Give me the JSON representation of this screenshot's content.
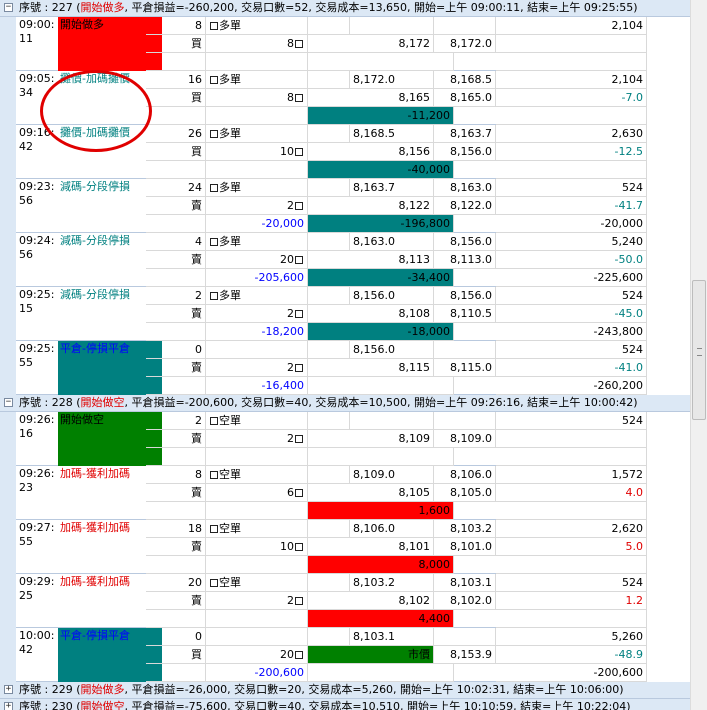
{
  "groups": [
    {
      "expander": "−",
      "prefix": "序號 : 227 (",
      "kind": "開始做多",
      "summary": ", 平倉損益=-260,200, 交易口數=52, 交易成本=13,650, 開始=上午 09:00:11, 結束=上午 09:25:55)",
      "blocks": [
        {
          "time1": "09:00:",
          "time2": "11",
          "action": "開始做多",
          "action_style": "bg-red",
          "r1": {
            "qty": "8",
            "side": "多單",
            "entry": "",
            "price": "",
            "right": "2,104"
          },
          "r2": {
            "dir": "買",
            "lots": "8",
            "num": "8,172",
            "price": "8,172.0",
            "right": ""
          },
          "r3": {
            "pnl": "",
            "bar": "",
            "right": "",
            "bar_style": ""
          }
        },
        {
          "time1": "09:05:",
          "time2": "34",
          "action": "攤價-加碼攤價",
          "action_style": "c-teal",
          "r1": {
            "qty": "16",
            "side": "多單",
            "entry": "8,172.0",
            "price": "8,168.5",
            "right": "2,104"
          },
          "r2": {
            "dir": "買",
            "lots": "8",
            "num": "8,165",
            "price": "8,165.0",
            "right": "-7.0"
          },
          "r3": {
            "pnl": "",
            "bar": "-11,200",
            "right": "",
            "bar_style": "tealbar"
          }
        },
        {
          "time1": "09:16:",
          "time2": "42",
          "action": "攤價-加碼攤價",
          "action_style": "c-teal",
          "r1": {
            "qty": "26",
            "side": "多單",
            "entry": "8,168.5",
            "price": "8,163.7",
            "right": "2,630"
          },
          "r2": {
            "dir": "買",
            "lots": "10",
            "num": "8,156",
            "price": "8,156.0",
            "right": "-12.5"
          },
          "r3": {
            "pnl": "",
            "bar": "-40,000",
            "right": "",
            "bar_style": "tealbar"
          }
        },
        {
          "time1": "09:23:",
          "time2": "56",
          "action": "減碼-分段停損",
          "action_style": "c-teal",
          "r1": {
            "qty": "24",
            "side": "多單",
            "entry": "8,163.7",
            "price": "8,163.0",
            "right": "524"
          },
          "r2": {
            "dir": "賣",
            "lots": "2",
            "num": "8,122",
            "price": "8,122.0",
            "right": "-41.7"
          },
          "r3": {
            "pnl": "-20,000",
            "bar": "-196,800",
            "right": "-20,000",
            "bar_style": "tealbar"
          }
        },
        {
          "time1": "09:24:",
          "time2": "56",
          "action": "減碼-分段停損",
          "action_style": "c-teal",
          "r1": {
            "qty": "4",
            "side": "多單",
            "entry": "8,163.0",
            "price": "8,156.0",
            "right": "5,240"
          },
          "r2": {
            "dir": "賣",
            "lots": "20",
            "num": "8,113",
            "price": "8,113.0",
            "right": "-50.0"
          },
          "r3": {
            "pnl": "-205,600",
            "bar": "-34,400",
            "right": "-225,600",
            "bar_style": "tealbar"
          }
        },
        {
          "time1": "09:25:",
          "time2": "15",
          "action": "減碼-分段停損",
          "action_style": "c-teal",
          "r1": {
            "qty": "2",
            "side": "多單",
            "entry": "8,156.0",
            "price": "8,156.0",
            "right": "524"
          },
          "r2": {
            "dir": "賣",
            "lots": "2",
            "num": "8,108",
            "price": "8,110.5",
            "right": "-45.0"
          },
          "r3": {
            "pnl": "-18,200",
            "bar": "-18,000",
            "right": "-243,800",
            "bar_style": "tealbar"
          }
        },
        {
          "time1": "09:25:",
          "time2": "55",
          "action": "平倉-停損平倉",
          "action_style": "bg-teal",
          "r1": {
            "qty": "0",
            "side": "",
            "entry": "8,156.0",
            "price": "",
            "right": "524"
          },
          "r2": {
            "dir": "賣",
            "lots": "2",
            "num": "8,115",
            "price": "8,115.0",
            "right": "-41.0"
          },
          "r3": {
            "pnl": "-16,400",
            "bar": "",
            "right": "-260,200",
            "bar_style": ""
          }
        }
      ]
    },
    {
      "expander": "−",
      "prefix": "序號 : 228 (",
      "kind": "開始做空",
      "summary": ", 平倉損益=-200,600, 交易口數=40, 交易成本=10,500, 開始=上午 09:26:16, 結束=上午 10:00:42)",
      "blocks": [
        {
          "time1": "09:26:",
          "time2": "16",
          "action": "開始做空",
          "action_style": "bg-green",
          "r1": {
            "qty": "2",
            "side": "空單",
            "entry": "",
            "price": "",
            "right": "524"
          },
          "r2": {
            "dir": "賣",
            "lots": "2",
            "num": "8,109",
            "price": "8,109.0",
            "right": ""
          },
          "r3": {
            "pnl": "",
            "bar": "",
            "right": "",
            "bar_style": ""
          }
        },
        {
          "time1": "09:26:",
          "time2": "23",
          "action": "加碼-獲利加碼",
          "action_style": "c-red",
          "r1": {
            "qty": "8",
            "side": "空單",
            "entry": "8,109.0",
            "price": "8,106.0",
            "right": "1,572"
          },
          "r2": {
            "dir": "賣",
            "lots": "6",
            "num": "8,105",
            "price": "8,105.0",
            "right": "4.0"
          },
          "r3": {
            "pnl": "",
            "bar": "1,600",
            "right": "",
            "bar_style": "redbar"
          }
        },
        {
          "time1": "09:27:",
          "time2": "55",
          "action": "加碼-獲利加碼",
          "action_style": "c-red",
          "r1": {
            "qty": "18",
            "side": "空單",
            "entry": "8,106.0",
            "price": "8,103.2",
            "right": "2,620"
          },
          "r2": {
            "dir": "賣",
            "lots": "10",
            "num": "8,101",
            "price": "8,101.0",
            "right": "5.0"
          },
          "r3": {
            "pnl": "",
            "bar": "8,000",
            "right": "",
            "bar_style": "redbar"
          }
        },
        {
          "time1": "09:29:",
          "time2": "25",
          "action": "加碼-獲利加碼",
          "action_style": "c-red",
          "r1": {
            "qty": "20",
            "side": "空單",
            "entry": "8,103.2",
            "price": "8,103.1",
            "right": "524"
          },
          "r2": {
            "dir": "賣",
            "lots": "2",
            "num": "8,102",
            "price": "8,102.0",
            "right": "1.2"
          },
          "r3": {
            "pnl": "",
            "bar": "4,400",
            "right": "",
            "bar_style": "redbar"
          }
        },
        {
          "time1": "10:00:",
          "time2": "42",
          "action": "平倉-停損平倉",
          "action_style": "bg-teal",
          "r1": {
            "qty": "0",
            "side": "",
            "entry": "8,103.1",
            "price": "",
            "right": "5,260"
          },
          "r2": {
            "dir": "買",
            "lots": "20",
            "num": "市價",
            "price": "8,153.9",
            "right": "-48.9"
          },
          "r3": {
            "pnl": "-200,600",
            "bar": "",
            "right": "-200,600",
            "bar_style": ""
          }
        }
      ]
    }
  ],
  "footer_groups": [
    {
      "expander": "+",
      "prefix": "序號 : 229 (",
      "kind": "開始做多",
      "summary": ", 平倉損益=-26,000, 交易口數=20, 交易成本=5,260, 開始=上午 10:02:31, 結束=上午 10:06:00)"
    },
    {
      "expander": "+",
      "prefix": "序號 : 230 (",
      "kind": "開始做空",
      "summary": ", 平倉損益=-75,600, 交易口數=40, 交易成本=10,510, 開始=上午 10:10:59, 結束=上午 10:22:04)"
    }
  ]
}
